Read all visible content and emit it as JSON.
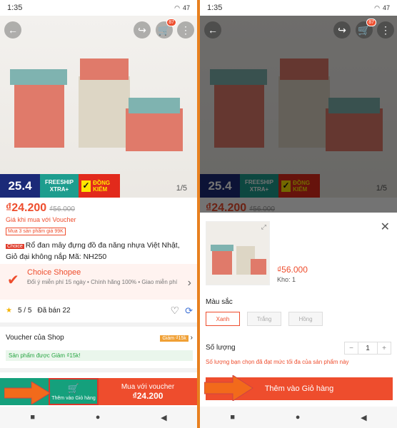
{
  "status": {
    "time": "1:35",
    "battery": "47",
    "icons": "⚠ ⏰"
  },
  "product": {
    "price": "₫24.200",
    "old_price": "₫56.000",
    "voucher_line": "Giá khi mua với",
    "voucher_word": "Voucher",
    "bulk_tag": "Mua 3 sản phẩm giá 99K",
    "choice_label": "Choice",
    "title": "Rổ đan mây đựng đồ đa năng nhựa Việt Nhật, Giỏ đại không nắp Mã: NH250",
    "image_counter": "1/5",
    "cart_badge": "87"
  },
  "promo": {
    "day": "25.4",
    "freeship": "FREESHIP",
    "xtra": "XTRA+",
    "dong_kiem": "ĐỒNG KIỂM"
  },
  "choice": {
    "title": "Choice Shopee",
    "desc": "Đổi ý miễn phí 15 ngày • Chính hãng 100% • Giao miễn phí"
  },
  "rating": {
    "score": "5 / 5",
    "sold": "Đã bán 22"
  },
  "voucher": {
    "label": "Voucher của Shop",
    "tag": "Giảm ₫15k",
    "note": "Sản phẩm được Giảm ₫15k!"
  },
  "bottom": {
    "add_cart": "Thêm vào Giỏ hàng",
    "buy_voucher": "Mua với voucher",
    "buy_price": "₫24.200"
  },
  "sheet": {
    "price": "₫56.000",
    "stock": "Kho: 1",
    "color_label": "Màu sắc",
    "options": [
      "Xanh",
      "Trắng",
      "Hồng"
    ],
    "qty_label": "Số lượng",
    "qty": "1",
    "warning": "Số lượng bạn chọn đã đạt mức tối đa của sản phẩm này",
    "add_button": "Thêm vào Giỏ hàng"
  }
}
